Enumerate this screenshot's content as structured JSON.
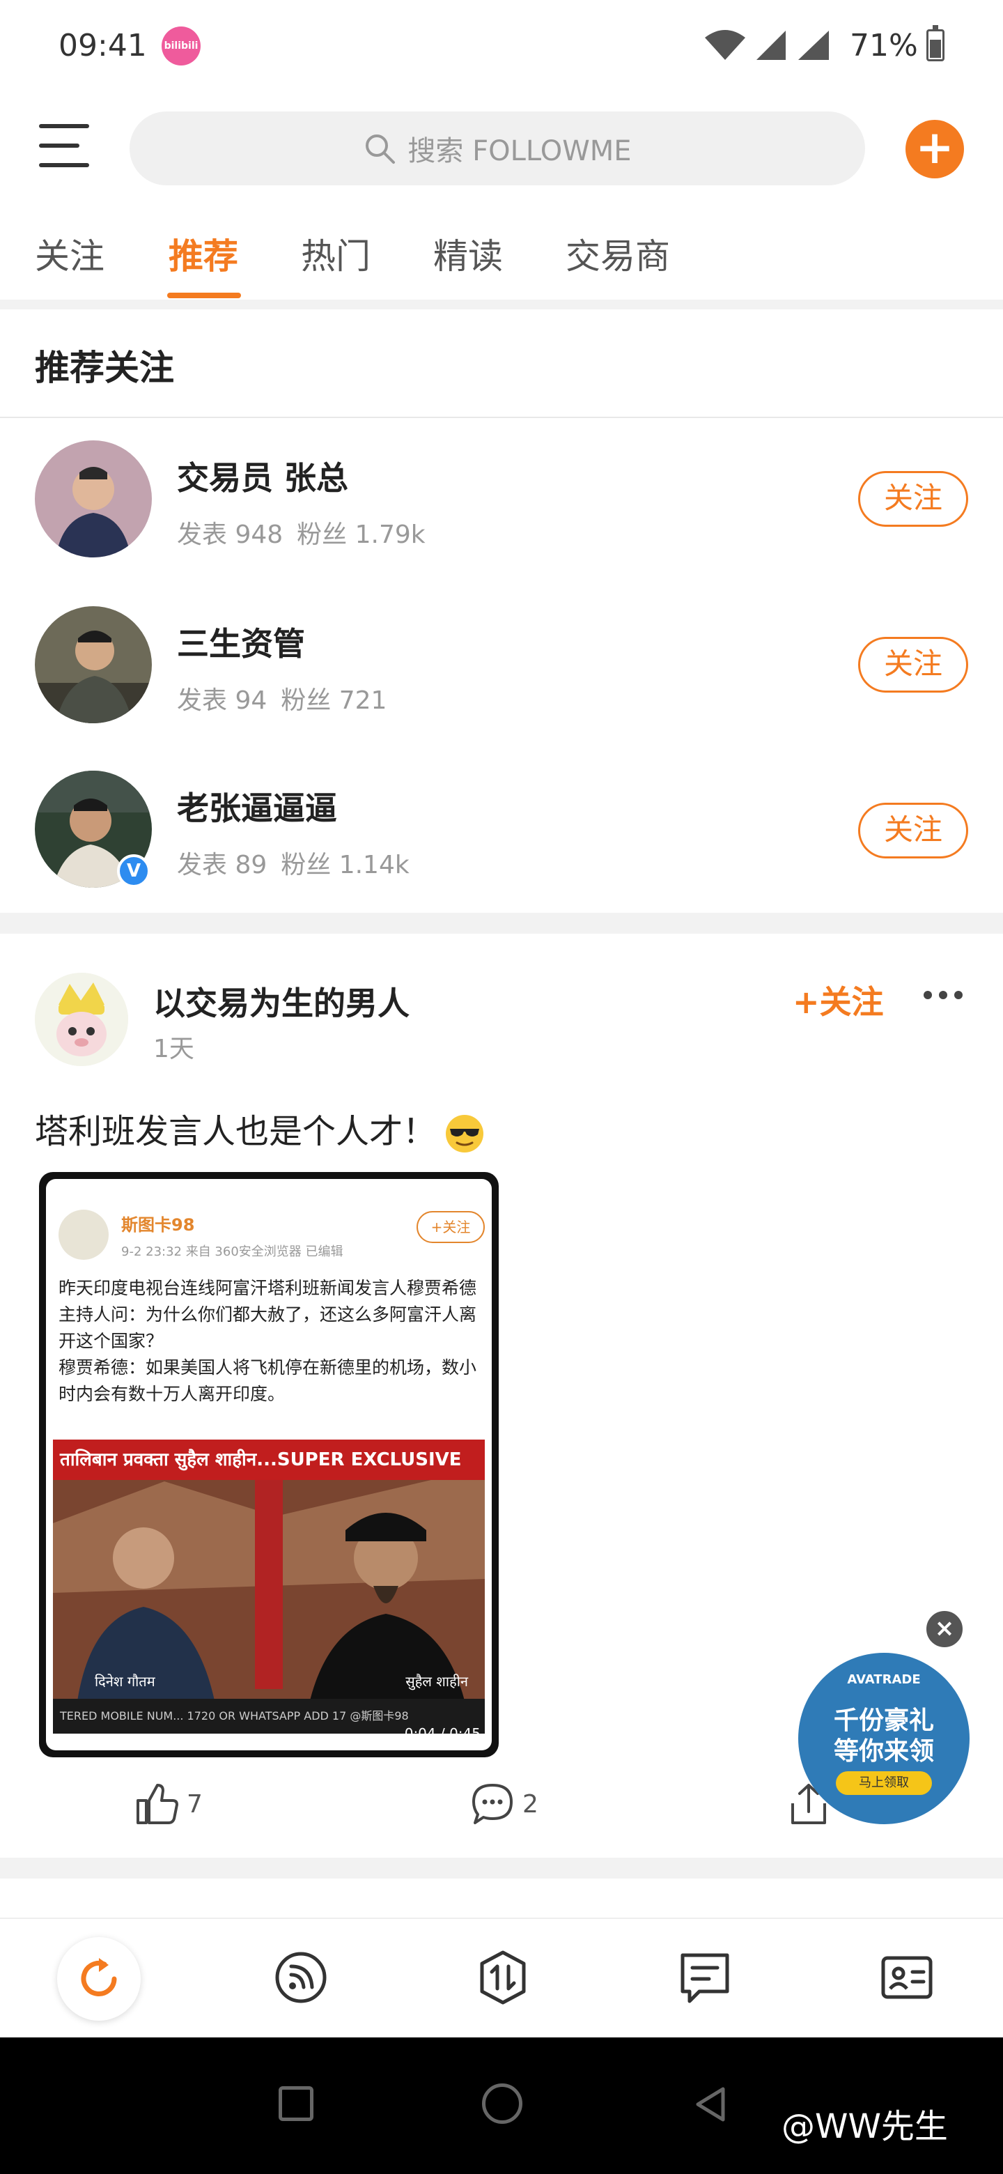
{
  "status_bar": {
    "time": "09:41",
    "app_badge": "bilibili",
    "battery": "71%"
  },
  "header": {
    "search_placeholder": "搜索 FOLLOWME"
  },
  "tabs": [
    {
      "label": "关注"
    },
    {
      "label": "推荐"
    },
    {
      "label": "热门"
    },
    {
      "label": "精读"
    },
    {
      "label": "交易商"
    }
  ],
  "recommended": {
    "title": "推荐关注",
    "follow_label": "关注",
    "users": [
      {
        "name": "交易员  张总",
        "posts_label": "发表 948",
        "fans_label": "粉丝 1.79k"
      },
      {
        "name": "三生资管",
        "posts_label": "发表 94",
        "fans_label": "粉丝 721"
      },
      {
        "name": "老张逼逼逼",
        "posts_label": "发表 89",
        "fans_label": "粉丝 1.14k",
        "verified": true
      }
    ]
  },
  "post": {
    "author": "以交易为生的男人",
    "time": "1天",
    "follow_label": "+关注",
    "text": "塔利班发言人也是个人才！",
    "likes": "7",
    "comments": "2",
    "image": {
      "user": "斯图卡98",
      "meta": "9-2 23:32  来自 360安全浏览器  已编辑",
      "follow": "+关注",
      "body": "昨天印度电视台连线阿富汗塔利班新闻发言人穆贾希德\n主持人问：为什么你们都大赦了，还这么多阿富汗人离开这个国家？\n穆贾希德：如果美国人将飞机停在新德里的机场，数小时内会有数十万人离开印度。",
      "news_banner": "तालिबान प्रवक्ता सुहैल शाहीन...SUPER EXCLUSIVE",
      "name_left": "दिनेश गौतम",
      "name_right": "सुहैल शाहीन",
      "ticker": "TERED MOBILE NUM... 1720 OR WHATSAPP ADD 17  @斯图卡98",
      "video_time": "0:04 / 0:45"
    }
  },
  "ad": {
    "brand": "AVATRADE",
    "line1": "千份豪礼",
    "line2": "等你来领",
    "button": "马上领取",
    "close": "×"
  },
  "watermark": "@WW先生",
  "colors": {
    "accent": "#f47b20",
    "verified": "#2d8cf0"
  }
}
